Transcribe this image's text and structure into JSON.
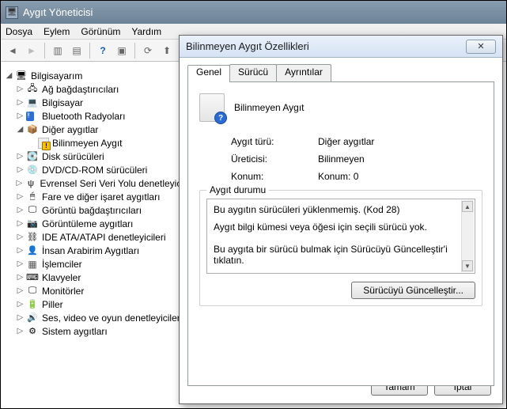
{
  "window": {
    "title": "Aygıt Yöneticisi"
  },
  "menubar": [
    "Dosya",
    "Eylem",
    "Görünüm",
    "Yardım"
  ],
  "tree": {
    "root": "Bilgisayarım",
    "items": [
      {
        "label": "Ağ bağdaştırıcıları",
        "icon": "network-icon"
      },
      {
        "label": "Bilgisayar",
        "icon": "computer-icon"
      },
      {
        "label": "Bluetooth Radyoları",
        "icon": "bluetooth-icon"
      },
      {
        "label": "Diğer aygıtlar",
        "icon": "other-devices-icon",
        "expanded": true,
        "children": [
          {
            "label": "Bilinmeyen Aygıt",
            "icon": "unknown-device-icon"
          }
        ]
      },
      {
        "label": "Disk sürücüleri",
        "icon": "disk-icon"
      },
      {
        "label": "DVD/CD-ROM sürücüleri",
        "icon": "dvd-icon"
      },
      {
        "label": "Evrensel Seri Veri Yolu denetleyicileri",
        "icon": "usb-icon"
      },
      {
        "label": "Fare ve diğer işaret aygıtları",
        "icon": "mouse-icon"
      },
      {
        "label": "Görüntü bağdaştırıcıları",
        "icon": "display-adapter-icon"
      },
      {
        "label": "Görüntüleme aygıtları",
        "icon": "imaging-icon"
      },
      {
        "label": "IDE ATA/ATAPI denetleyicileri",
        "icon": "ide-icon"
      },
      {
        "label": "İnsan Arabirim Aygıtları",
        "icon": "hid-icon"
      },
      {
        "label": "İşlemciler",
        "icon": "cpu-icon"
      },
      {
        "label": "Klavyeler",
        "icon": "keyboard-icon"
      },
      {
        "label": "Monitörler",
        "icon": "monitor-icon"
      },
      {
        "label": "Piller",
        "icon": "battery-icon"
      },
      {
        "label": "Ses, video ve oyun denetleyicileri",
        "icon": "audio-icon"
      },
      {
        "label": "Sistem aygıtları",
        "icon": "system-icon"
      }
    ]
  },
  "dialog": {
    "title": "Bilinmeyen Aygıt Özellikleri",
    "tabs": [
      "Genel",
      "Sürücü",
      "Ayrıntılar"
    ],
    "active_tab": 0,
    "device_name": "Bilinmeyen Aygıt",
    "rows": {
      "type_label": "Aygıt türü:",
      "type_value": "Diğer aygıtlar",
      "manuf_label": "Üreticisi:",
      "manuf_value": "Bilinmeyen",
      "loc_label": "Konum:",
      "loc_value": "Konum: 0"
    },
    "status_group": "Aygıt durumu",
    "status_text_1": "Bu aygıtın sürücüleri yüklenmemiş. (Kod 28)",
    "status_text_2": "Aygıt bilgi kümesi veya öğesi için seçili sürücü yok.",
    "status_text_3": "Bu aygıta bir sürücü bulmak için Sürücüyü Güncelleştir'i tıklatın.",
    "update_button": "Sürücüyü Güncelleştir...",
    "ok_button": "Tamam",
    "cancel_button": "İptal"
  }
}
